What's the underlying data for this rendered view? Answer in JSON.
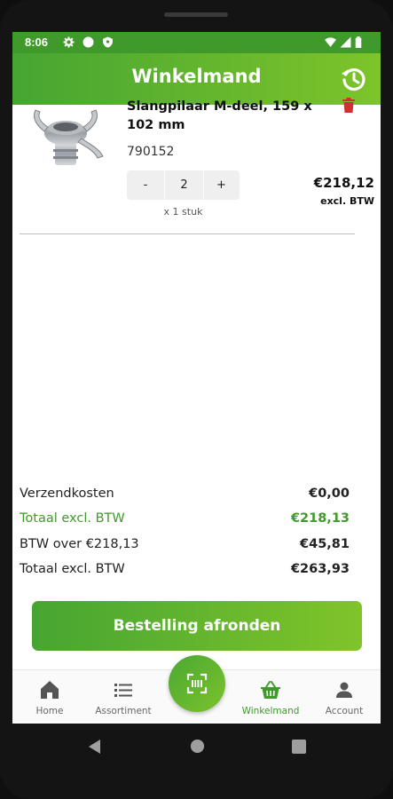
{
  "status": {
    "time": "8:06"
  },
  "header": {
    "title": "Winkelmand"
  },
  "cart": {
    "items": [
      {
        "name": "Slangpilaar M-deel, 159 x 102 mm",
        "sku": "790152",
        "qty_minus": "-",
        "qty": "2",
        "qty_plus": "+",
        "unit": "x 1 stuk",
        "price": "€218,12",
        "price_note": "excl. BTW"
      }
    ]
  },
  "totals": [
    {
      "label": "Verzendkosten",
      "value": "€0,00"
    },
    {
      "label": "Totaal excl. BTW",
      "value": "€218,13"
    },
    {
      "label": "BTW over €218,13",
      "value": "€45,81"
    },
    {
      "label": "Totaal excl. BTW",
      "value": "€263,93"
    }
  ],
  "checkout": {
    "label": "Bestelling afronden"
  },
  "nav": [
    {
      "label": "Home",
      "icon": "home-icon"
    },
    {
      "label": "Assortiment",
      "icon": "list-icon"
    },
    {
      "label": "",
      "icon": "scan-icon"
    },
    {
      "label": "Winkelmand",
      "icon": "basket-icon",
      "active": true
    },
    {
      "label": "Account",
      "icon": "person-icon"
    }
  ],
  "colors": {
    "brand": "#46a532",
    "brand_light": "#80c42a",
    "danger": "#d32f2f"
  }
}
